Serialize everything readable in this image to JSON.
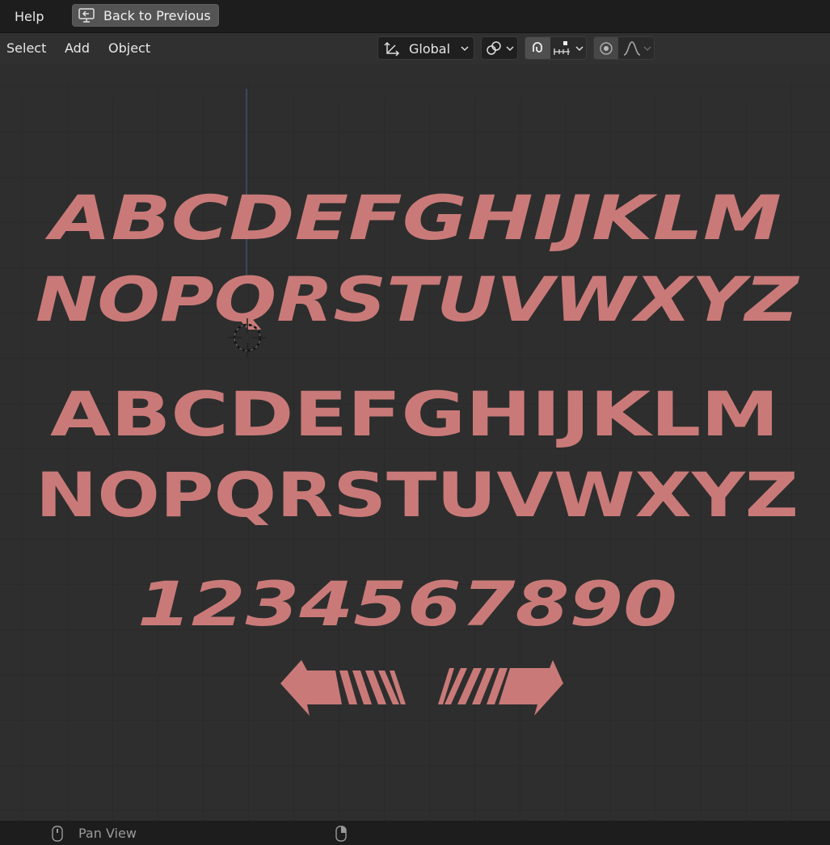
{
  "topbar": {
    "help_label": "Help",
    "back_label": "Back to Previous"
  },
  "header": {
    "menus": [
      "Select",
      "Add",
      "Object"
    ],
    "orientation": "Global"
  },
  "viewport": {
    "text_color": "#c97a78",
    "rows": {
      "italic_upper_1": "ABCDEFGHIJKLM",
      "italic_upper_2": "NOPQRSTUVWXYZ",
      "regular_upper_1": "ABCDEFGHIJKLM",
      "regular_upper_2": "NOPQRSTUVWXYZ",
      "digits": "1234567890"
    }
  },
  "status": {
    "pan_view_label": "Pan View"
  }
}
